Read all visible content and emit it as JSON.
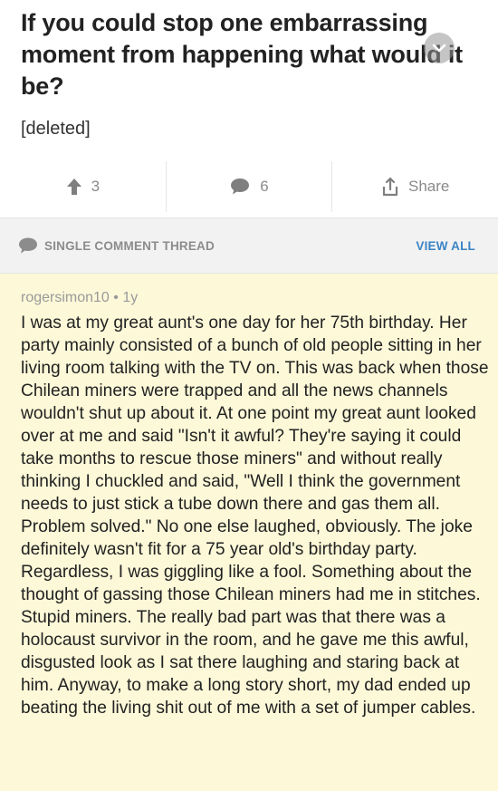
{
  "post": {
    "title": "If you could stop one embarrassing moment from happening what would it be?",
    "body": "[deleted]"
  },
  "actions": {
    "upvote_count": "3",
    "comment_count": "6",
    "share_label": "Share"
  },
  "thread_bar": {
    "label": "SINGLE COMMENT THREAD",
    "view_all_label": "VIEW ALL"
  },
  "comment": {
    "author": "rogersimon10",
    "age": "1y",
    "body": "I was at my great aunt's one day for her 75th birthday. Her party mainly consisted of a bunch of old people sitting in her living room talking with the TV on. This was back when those Chilean miners were trapped and all the news channels wouldn't shut up about it. At one point my great aunt looked over at me and said \"Isn't it awful? They're saying it could take months to rescue those miners\" and without really thinking I chuckled and said, \"Well I think the government needs to just stick a tube down there and gas them all. Problem solved.\" No one else laughed, obviously. The joke definitely wasn't fit for a 75 year old's birthday party. Regardless, I was giggling like a fool. Something about the thought of gassing those Chilean miners had me in stitches. Stupid miners. The really bad part was that there was a holocaust survivor in the room, and he gave me this awful, disgusted look as I sat there laughing and staring back at him. Anyway, to make a long story short, my dad ended up beating the living shit out of me with a set of jumper cables."
  },
  "colors": {
    "accent_link": "#3b84c4",
    "comment_background": "#fcf8d8",
    "icon_gray": "#8a8a8a"
  }
}
